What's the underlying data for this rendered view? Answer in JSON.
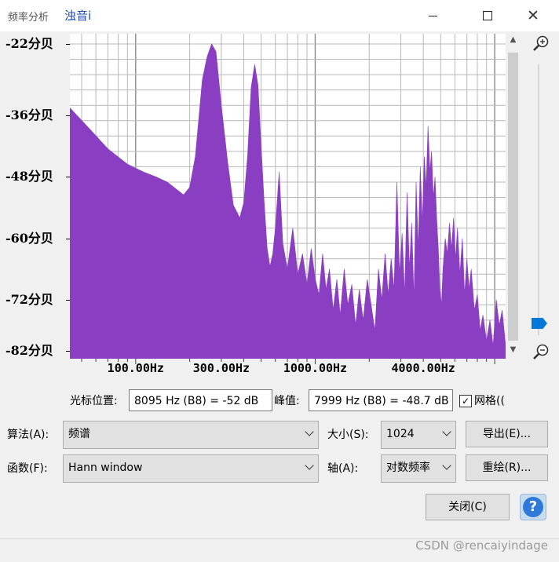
{
  "window": {
    "app_title": "频率分析",
    "doc_title": "浊音i",
    "minimize_symbol": "",
    "close_symbol": "✕"
  },
  "chart_data": {
    "type": "area",
    "y_axis": {
      "tick_labels": [
        "-22分贝",
        "-36分贝",
        "-48分贝",
        "-60分贝",
        "-72分贝",
        "-82分贝"
      ],
      "tick_values": [
        -22,
        -36,
        -48,
        -60,
        -72,
        -82
      ],
      "range": [
        -82,
        -22
      ]
    },
    "x_axis": {
      "scale": "log",
      "range_hz": [
        43,
        11500
      ],
      "tick_labels": [
        "100.00Hz",
        "300.00Hz",
        "1000.00Hz",
        "4000.00Hz"
      ],
      "tick_values_hz": [
        100,
        300,
        1000,
        4000
      ]
    },
    "grid": true,
    "fill_color": "#8a3fc2",
    "series": [
      {
        "x_hz": [
          43,
          55,
          70,
          90,
          110,
          130,
          150,
          170,
          185,
          200,
          215,
          235,
          250,
          265,
          280,
          300,
          325,
          350,
          380,
          400,
          420,
          440,
          460,
          480,
          500,
          520,
          540,
          560,
          580,
          600,
          630,
          660,
          700,
          750,
          800,
          850,
          900,
          950,
          1000,
          1050,
          1100,
          1150,
          1200,
          1260,
          1320,
          1380,
          1450,
          1520,
          1600,
          1680,
          1760,
          1850,
          1950,
          2050,
          2150,
          2250,
          2350,
          2450,
          2550,
          2650,
          2750,
          2850,
          2950,
          3050,
          3150,
          3250,
          3350,
          3450,
          3550,
          3650,
          3750,
          3850,
          3950,
          4050,
          4150,
          4250,
          4350,
          4450,
          4550,
          4650,
          4750,
          4850,
          4950,
          5050,
          5150,
          5300,
          5450,
          5600,
          5750,
          5900,
          6050,
          6200,
          6400,
          6600,
          6800,
          7000,
          7200,
          7400,
          7700,
          8000,
          8300,
          8600,
          9000,
          9400,
          9800,
          10200,
          10600,
          11000,
          11500
        ],
        "y_db": [
          -34.5,
          -38.5,
          -42.5,
          -45.5,
          -47.0,
          -48.0,
          -49.0,
          -50.5,
          -51.5,
          -50.0,
          -44.0,
          -29.0,
          -24.5,
          -22.0,
          -23.5,
          -34.0,
          -45.0,
          -53.5,
          -56.0,
          -53.0,
          -44.0,
          -30.5,
          -26.0,
          -30.0,
          -42.0,
          -53.0,
          -62.0,
          -65.5,
          -63.0,
          -58.0,
          -47.0,
          -61.0,
          -66.0,
          -58.0,
          -67.0,
          -63.0,
          -69.0,
          -62.0,
          -68.0,
          -71.0,
          -63.0,
          -70.0,
          -66.0,
          -74.0,
          -68.0,
          -75.0,
          -66.0,
          -73.0,
          -69.0,
          -77.0,
          -70.0,
          -76.0,
          -68.0,
          -73.0,
          -78.0,
          -66.0,
          -72.0,
          -63.0,
          -71.0,
          -64.0,
          -70.0,
          -49.0,
          -67.0,
          -59.0,
          -71.0,
          -51.0,
          -66.0,
          -57.0,
          -72.0,
          -49.0,
          -62.0,
          -46.0,
          -57.0,
          -44.0,
          -50.0,
          -38.0,
          -47.0,
          -43.0,
          -52.0,
          -48.0,
          -56.0,
          -62.0,
          -70.0,
          -73.0,
          -66.0,
          -60.0,
          -63.0,
          -57.0,
          -62.0,
          -56.0,
          -64.0,
          -58.0,
          -67.0,
          -60.0,
          -71.0,
          -64.0,
          -70.0,
          -66.0,
          -74.0,
          -71.0,
          -78.0,
          -75.0,
          -80.0,
          -76.0,
          -81.0,
          -72.0,
          -77.0,
          -74.0,
          -81.0
        ]
      }
    ]
  },
  "info": {
    "cursor_label": "光标位置:",
    "cursor_value": "8095 Hz (B8) = -52 dB",
    "peak_label": "峰值:",
    "peak_value": "7999 Hz (B8) = -48.7 dB",
    "grid_checked": true,
    "grid_check_mark": "✓",
    "grid_label": "网格(("
  },
  "controls": {
    "algorithm_label": "算法(A):",
    "algorithm_value": "频谱",
    "function_label": "函数(F):",
    "function_value": "Hann window",
    "size_label": "大小(S):",
    "size_value": "1024",
    "axis_label": "轴(A):",
    "axis_value": "对数频率",
    "export_button": "导出(E)...",
    "replot_button": "重绘(R)...",
    "close_button": "关闭(C)",
    "help_symbol": "?"
  },
  "watermark": "CSDN @rencaiyindage"
}
